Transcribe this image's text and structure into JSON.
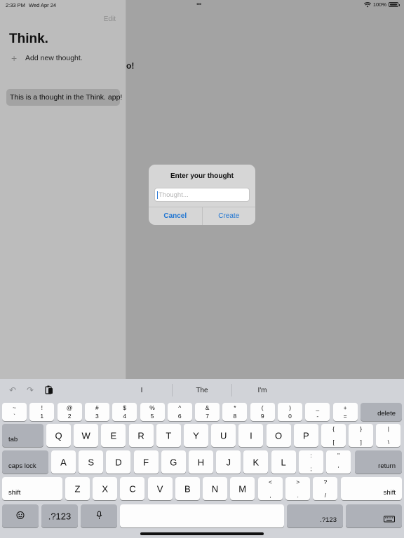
{
  "status": {
    "time": "2:33 PM",
    "date": "Wed Apr 24",
    "battery": "100%"
  },
  "sidebar": {
    "edit_label": "Edit",
    "title": "Think.",
    "add_label": "Add new thought.",
    "items": [
      {
        "label": "This is a thought in the Think. app!"
      }
    ]
  },
  "detail": {
    "peek_text": "o!"
  },
  "alert": {
    "title": "Enter your thought",
    "placeholder": "Thought...",
    "value": "",
    "cancel_label": "Cancel",
    "create_label": "Create"
  },
  "keyboard": {
    "suggestions": [
      "I",
      "The",
      "I'm"
    ],
    "number_row": [
      {
        "top": "~",
        "bottom": "`"
      },
      {
        "top": "!",
        "bottom": "1"
      },
      {
        "top": "@",
        "bottom": "2"
      },
      {
        "top": "#",
        "bottom": "3"
      },
      {
        "top": "$",
        "bottom": "4"
      },
      {
        "top": "%",
        "bottom": "5"
      },
      {
        "top": "^",
        "bottom": "6"
      },
      {
        "top": "&",
        "bottom": "7"
      },
      {
        "top": "*",
        "bottom": "8"
      },
      {
        "top": "(",
        "bottom": "9"
      },
      {
        "top": ")",
        "bottom": "0"
      },
      {
        "top": "_",
        "bottom": "-"
      },
      {
        "top": "+",
        "bottom": "="
      }
    ],
    "delete_label": "delete",
    "tab_label": "tab",
    "row1": [
      "Q",
      "W",
      "E",
      "R",
      "T",
      "Y",
      "U",
      "I",
      "O",
      "P"
    ],
    "row1_punct": [
      {
        "top": "{",
        "bottom": "["
      },
      {
        "top": "}",
        "bottom": "]"
      },
      {
        "top": "|",
        "bottom": "\\"
      }
    ],
    "caps_label": "caps lock",
    "row2": [
      "A",
      "S",
      "D",
      "F",
      "G",
      "H",
      "J",
      "K",
      "L"
    ],
    "row2_punct": [
      {
        "top": ":",
        "bottom": ";"
      },
      {
        "top": "\"",
        "bottom": "'"
      }
    ],
    "return_label": "return",
    "shift_label": "shift",
    "row3": [
      "Z",
      "X",
      "C",
      "V",
      "B",
      "N",
      "M"
    ],
    "row3_punct": [
      {
        "top": "<",
        "bottom": ","
      },
      {
        "top": ">",
        "bottom": "."
      },
      {
        "top": "?",
        "bottom": "/"
      }
    ],
    "numbers_label": ".?123"
  }
}
